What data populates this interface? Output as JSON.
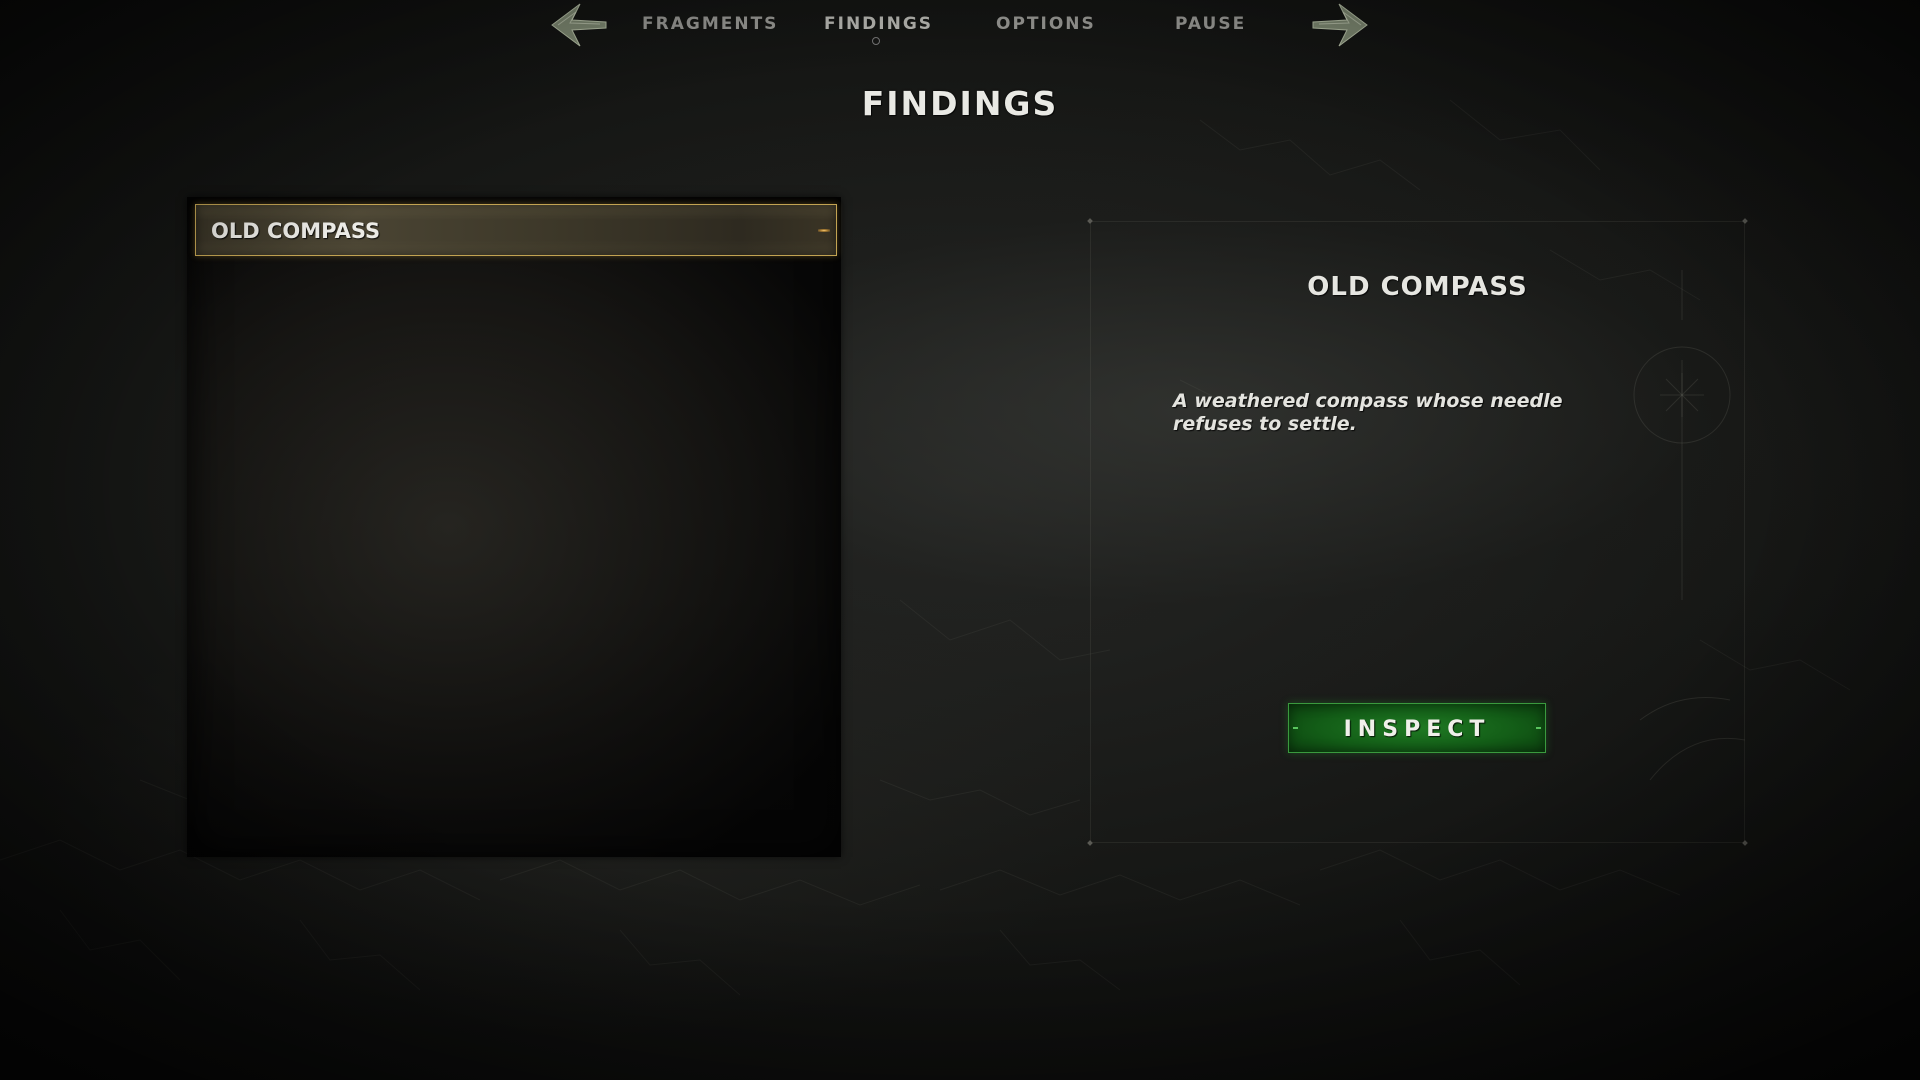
{
  "nav": {
    "tabs": [
      {
        "label": "FRAGMENTS",
        "active": false
      },
      {
        "label": "FINDINGS",
        "active": true
      },
      {
        "label": "OPTIONS",
        "active": false
      },
      {
        "label": "PAUSE",
        "active": false
      }
    ],
    "prev_icon": "arrow-left-icon",
    "next_icon": "arrow-right-icon"
  },
  "page": {
    "title": "FINDINGS"
  },
  "list": {
    "items": [
      {
        "label": "OLD COMPASS",
        "selected": true
      }
    ]
  },
  "detail": {
    "title": "OLD COMPASS",
    "description": "A weathered compass whose needle refuses to settle.",
    "inspect_label": "INSPECT"
  },
  "colors": {
    "accent_gold": "#c2a352",
    "inspect_green": "#1f7a23",
    "background": "#161715",
    "text": "#e9e9e4"
  }
}
